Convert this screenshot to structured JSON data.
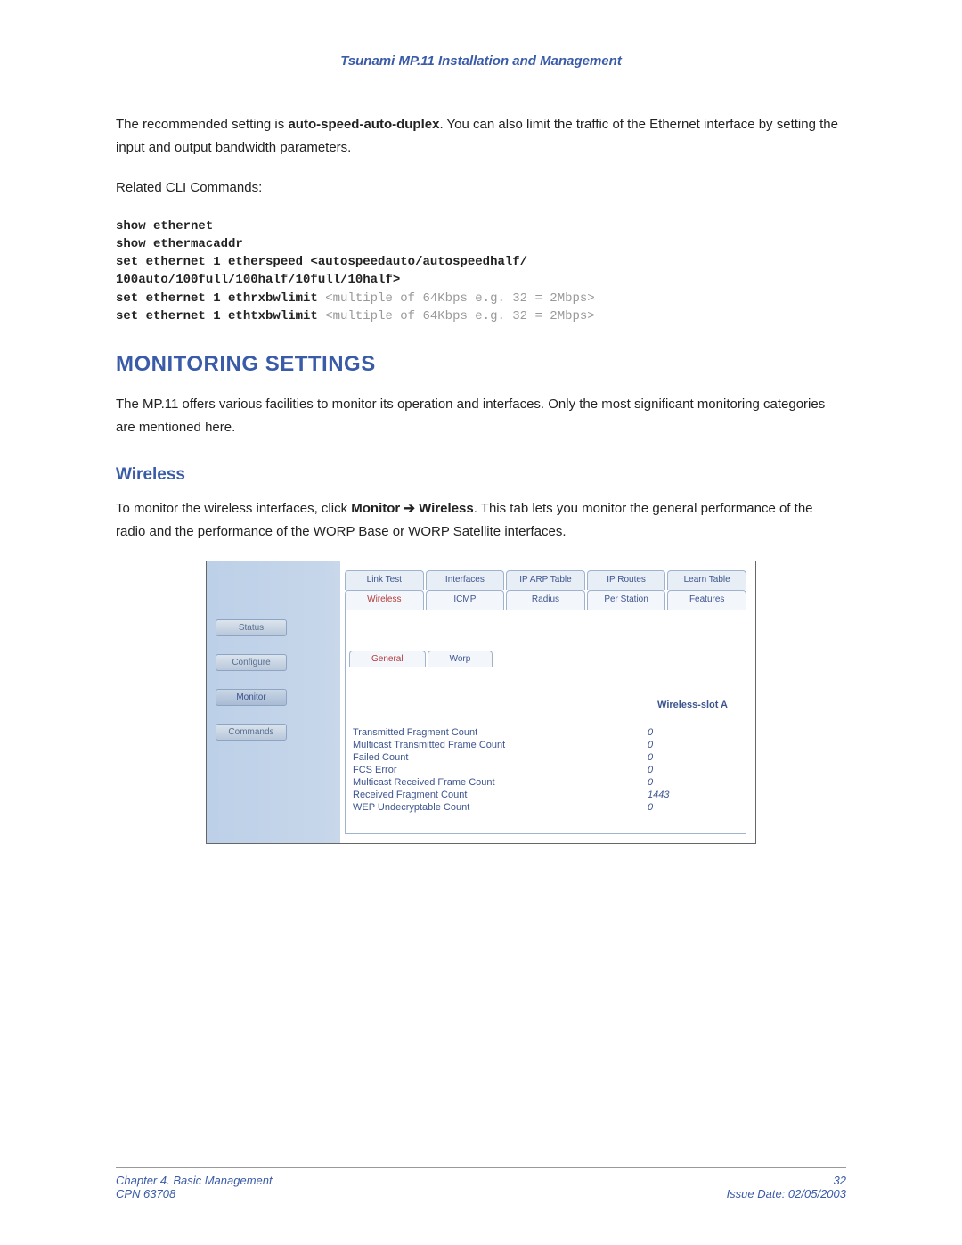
{
  "header": "Tsunami MP.11 Installation and Management",
  "para1_a": "The recommended setting is ",
  "para1_bold": "auto-speed-auto-duplex",
  "para1_b": ".  You can also limit the traffic of the Ethernet interface by setting the input and output bandwidth parameters.",
  "para2": "Related CLI Commands:",
  "cli": {
    "l1": "show ethernet",
    "l2": "show ethermacaddr",
    "l3a": "set ethernet 1 etherspeed",
    "l3b": " <autospeedauto/autospeedhalf/",
    "l4": "100auto/100full/100half/10full/10half>",
    "l5a": "set ethernet 1 ethrxbwlimit",
    "l5b": " <multiple of 64Kbps e.g. 32 = 2Mbps>",
    "l6a": "set ethernet 1 ethtxbwlimit",
    "l6b": " <multiple of 64Kbps e.g. 32 = 2Mbps>"
  },
  "h2": "MONITORING SETTINGS",
  "para3": "The MP.11 offers various facilities to monitor its operation and interfaces.  Only the most significant monitoring categories are mentioned here.",
  "h3": "Wireless",
  "para4_a": "To monitor the wireless interfaces, click ",
  "para4_b1": "Monitor",
  "para4_arrow": " ➔ ",
  "para4_b2": "Wireless",
  "para4_c": ".  This tab lets you monitor the general performance of the radio and the performance of the WORP Base or WORP Satellite interfaces.",
  "ui": {
    "side": [
      "Status",
      "Configure",
      "Monitor",
      "Commands"
    ],
    "tabs1": [
      "Link Test",
      "Interfaces",
      "IP ARP Table",
      "IP Routes",
      "Learn Table"
    ],
    "tabs2": [
      "Wireless",
      "ICMP",
      "Radius",
      "Per Station",
      "Features"
    ],
    "subtabs": [
      "General",
      "Worp"
    ],
    "col_header": "Wireless-slot A",
    "rows": [
      {
        "label": "Transmitted Fragment Count",
        "val": "0"
      },
      {
        "label": "Multicast Transmitted Frame Count",
        "val": "0"
      },
      {
        "label": "Failed Count",
        "val": "0"
      },
      {
        "label": "FCS Error",
        "val": "0"
      },
      {
        "label": "Multicast Received Frame Count",
        "val": "0"
      },
      {
        "label": "Received Fragment Count",
        "val": "1443"
      },
      {
        "label": "WEP Undecryptable Count",
        "val": "0"
      }
    ]
  },
  "footer": {
    "chapter": "Chapter 4.  Basic Management",
    "cpn": "CPN 63708",
    "page": "32",
    "issue": "Issue Date:  02/05/2003"
  }
}
